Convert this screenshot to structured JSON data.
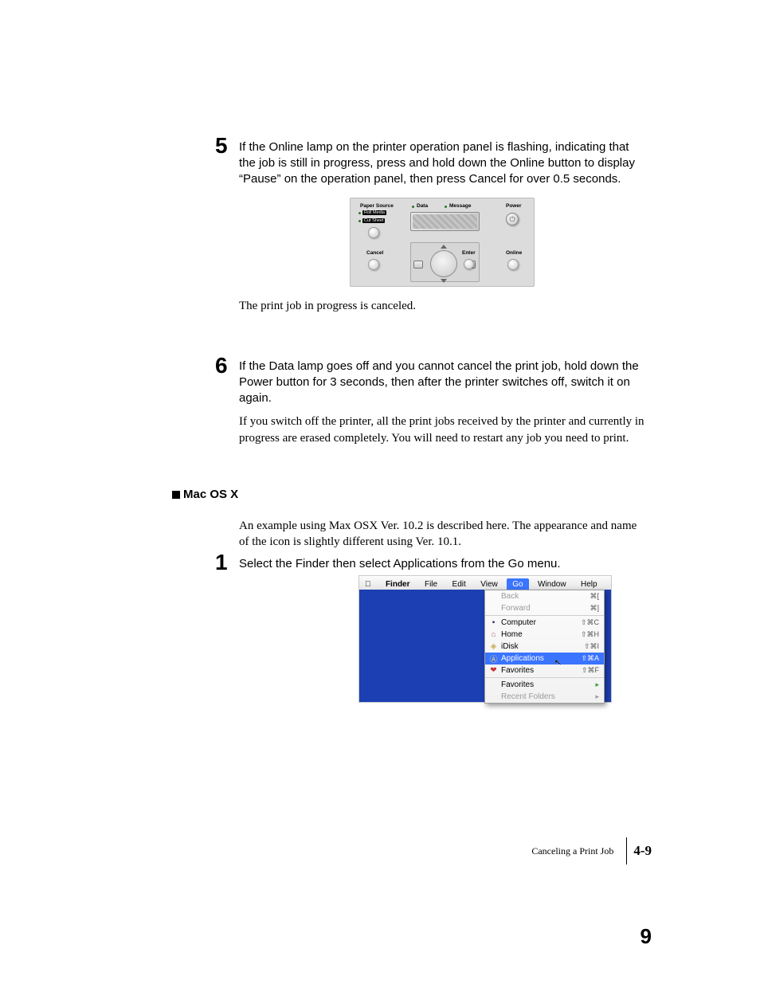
{
  "steps": {
    "five": {
      "num": "5",
      "text": "If the Online lamp on the printer operation panel is flashing, indicating that the job is still in progress, press and hold down the Online button to display “Pause” on the operation panel, then press Cancel for over 0.5 seconds.",
      "after": "The print job in progress is canceled."
    },
    "six": {
      "num": "6",
      "text": "If the Data lamp goes off and you cannot cancel the print job, hold down the Power button for 3 seconds, then after the printer switches off, switch it on again.",
      "after": "If you switch off the printer, all the print jobs received by the printer and currently in progress are erased completely. You will need to restart any job you need to print."
    },
    "one": {
      "num": "1",
      "text": "Select the Finder then select Applications from the Go menu."
    }
  },
  "section": {
    "macosx": "Mac OS X",
    "intro": "An example using Max OSX Ver. 10.2 is described here. The appearance and name of the icon is slightly different using Ver. 10.1."
  },
  "panel": {
    "paperSource": "Paper Source",
    "rollMedia": "Roll Media",
    "cutSheet": "Cut Sheet",
    "cancel": "Cancel",
    "data": "Data",
    "message": "Message",
    "enter": "Enter",
    "power": "Power",
    "online": "Online"
  },
  "mac": {
    "menubar": {
      "finder": "Finder",
      "file": "File",
      "edit": "Edit",
      "view": "View",
      "go": "Go",
      "window": "Window",
      "help": "Help"
    },
    "gomenu": {
      "back": {
        "label": "Back",
        "shortcut": "⌘["
      },
      "forward": {
        "label": "Forward",
        "shortcut": "⌘]"
      },
      "computer": {
        "label": "Computer",
        "shortcut": "⇧⌘C"
      },
      "home": {
        "label": "Home",
        "shortcut": "⇧⌘H"
      },
      "idisk": {
        "label": "iDisk",
        "shortcut": "⇧⌘I"
      },
      "applications": {
        "label": "Applications",
        "shortcut": "⇧⌘A"
      },
      "favorites": {
        "label": "Favorites",
        "shortcut": "⇧⌘F"
      },
      "favoritesSub": {
        "label": "Favorites"
      },
      "recent": {
        "label": "Recent Folders"
      }
    }
  },
  "footer": {
    "title": "Canceling a Print Job",
    "page": "4-9",
    "big": "9"
  }
}
